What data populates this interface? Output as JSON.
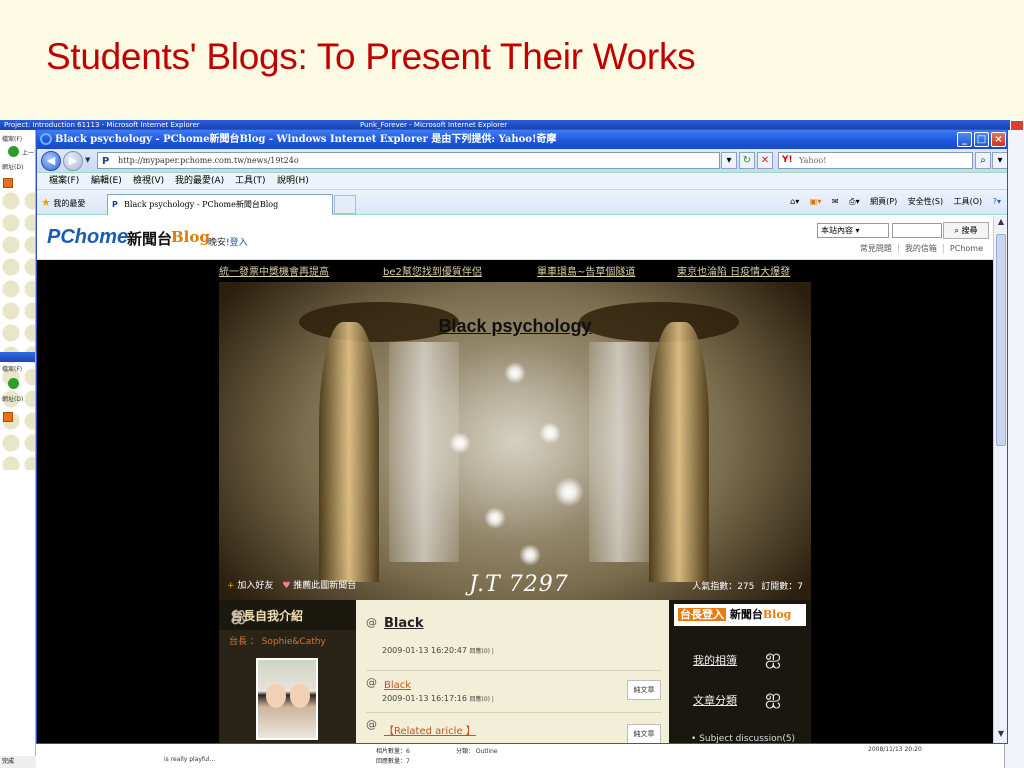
{
  "slide": {
    "title": "Students' Blogs: To Present Their Works"
  },
  "background": {
    "taskbar_left": "Project: Introduction 61113 - Microsoft Internet Explorer",
    "taskbar_mid": "Punk_Forever - Microsoft Internet Explorer",
    "left_strip_items": [
      "檔案(F)",
      "上一頁",
      "網址(D)",
      "檔案(F)",
      "網址(D)"
    ],
    "status_text": "完成",
    "bottom_texts": [
      "is really playful...",
      "相片數量：6",
      "回應數量：7",
      "分類： Outline",
      "2008/11/13 20:20"
    ]
  },
  "ie": {
    "title": "Black psychology - PChome新聞台Blog - Windows Internet Explorer 是由下列提供: Yahoo!奇摩",
    "address": "http://mypaper.pchome.com.tw/news/19t24o",
    "search_placeholder": "Yahoo!",
    "menu": [
      "檔案(F)",
      "編輯(E)",
      "檢視(V)",
      "我的最愛(A)",
      "工具(T)",
      "說明(H)"
    ],
    "favorites_label": "我的最愛",
    "tab_label": "Black psychology - PChome新聞台Blog",
    "command_bar": [
      "網頁(P)",
      "安全性(S)",
      "工具(O)"
    ]
  },
  "pchome": {
    "logo": "PChome",
    "news_label": "新聞台",
    "blog_label": "Blog",
    "greeting": "晚安!",
    "login_link": "登入",
    "site_select": "本站內容",
    "search_button": "搜尋",
    "links": [
      "常見問題",
      "我的信箱",
      "PChome"
    ]
  },
  "blog": {
    "ticker": [
      "統一發票中獎機會再提高",
      "be2幫您找到優質伴侶",
      "單車環島~告草個隧道",
      "東京也淪陷 日疫情大爆發"
    ],
    "title": "Black psychology",
    "add_friend": "加入好友",
    "recommend": "推薦此圖新聞台",
    "signature": "J.T 7297",
    "visitors": "人氣指數：275",
    "subscribers": "訂閱數：7",
    "about_header": "台長自我介紹",
    "owner": "台長 ： Sophie&Cathy",
    "posts": [
      {
        "title": "Black",
        "date": "2009-01-13 16:20:47",
        "meta": "回應(0) |"
      },
      {
        "title": "Black",
        "date": "2009-01-13 16:17:16",
        "meta": "回應(0) |",
        "tag": "純文章"
      },
      {
        "title": "【Related aricle 】",
        "tag": "純文章"
      }
    ],
    "login_banner": {
      "prefix": "台長登入",
      "news": "新聞台",
      "blog": "Blog"
    },
    "right_items": [
      "我的相簿",
      "文章分類"
    ],
    "right_sub": "Subject discussion(5)"
  }
}
